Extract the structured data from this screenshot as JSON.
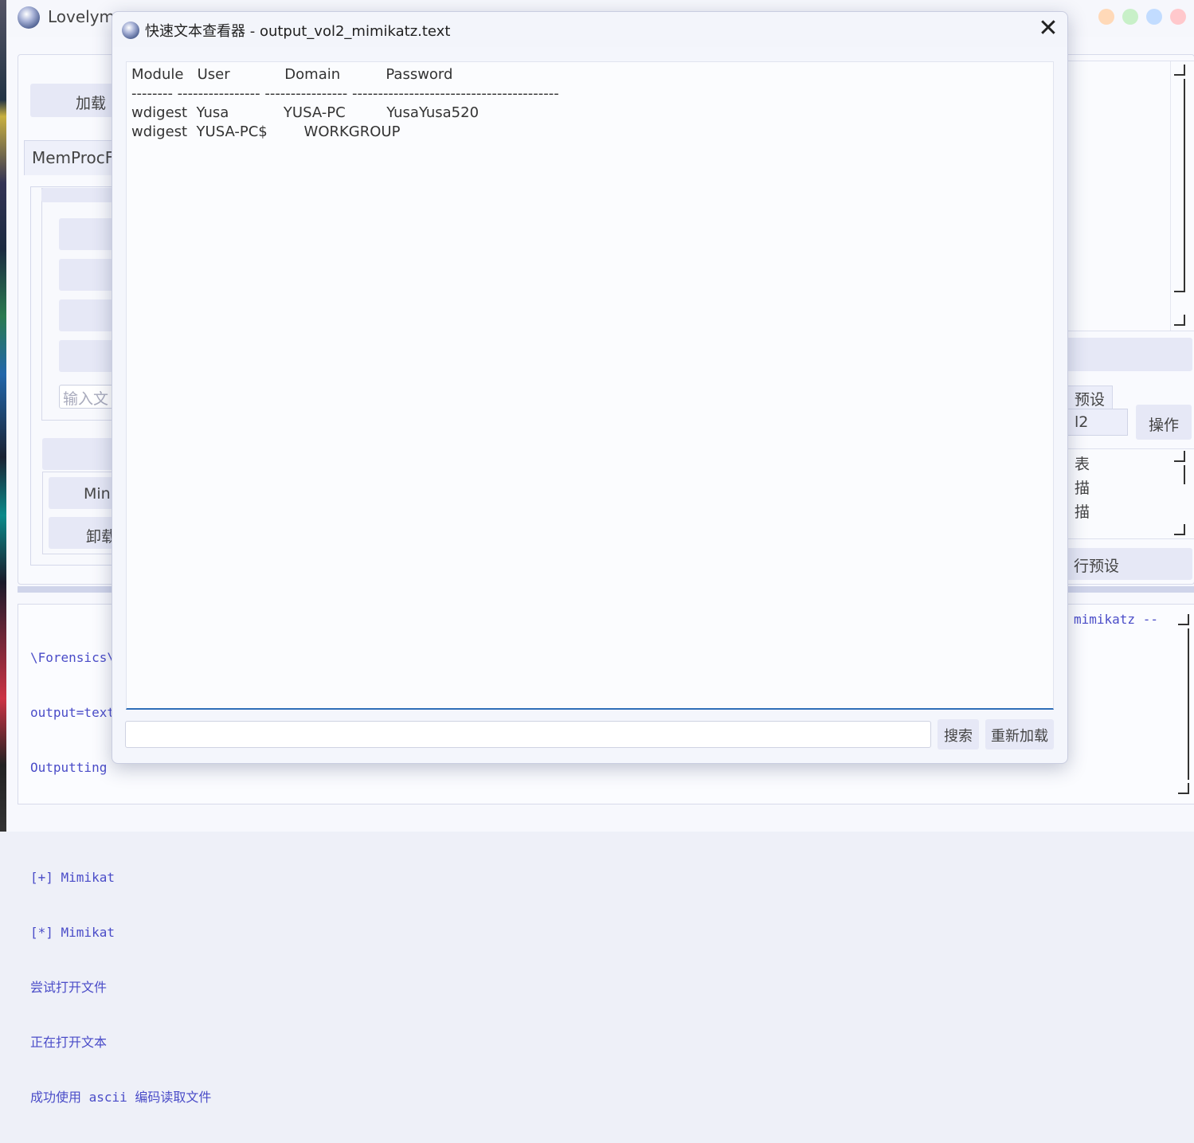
{
  "app": {
    "title": "Lovelym"
  },
  "left_panel": {
    "load_button": "加载",
    "tab_label": "MemProcF",
    "input_placeholder": "输入文",
    "mini_button": "Min",
    "unload_button": "卸载"
  },
  "right_panel": {
    "preset_tab": "预设",
    "combo_value": "l2",
    "ops_button": "操作",
    "list_items": [
      "表",
      "描",
      "描"
    ],
    "run_preset_button": "行预设"
  },
  "log": {
    "lines": [
      "\\Forensics\\",
      "output=text",
      "Outputting ",
      "",
      "[+] Mimikat",
      "[*] Mimikat",
      "尝试打开文件",
      "正在打开文本",
      "成功使用 ascii 编码读取文件"
    ],
    "right_fragment": "mimikatz --"
  },
  "dialog": {
    "title": "快速文本查看器 - output_vol2_mimikatz.text",
    "close_glyph": "✕",
    "text_lines": [
      "Module   User            Domain          Password",
      "-------- ---------------- ---------------- ----------------------------------------",
      "wdigest  Yusa            YUSA-PC         YusaYusa520",
      "wdigest  YUSA-PC$        WORKGROUP"
    ],
    "search_button": "搜索",
    "reload_button": "重新加载",
    "search_placeholder": ""
  }
}
